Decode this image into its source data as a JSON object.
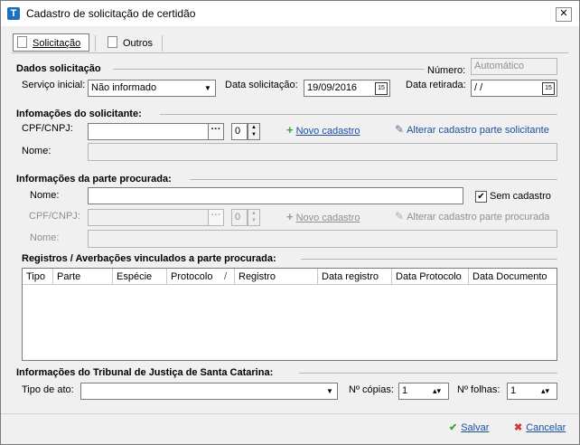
{
  "window": {
    "title": "Cadastro de solicitação de certidão",
    "close_glyph": "✕",
    "app_icon": "T"
  },
  "tabs": [
    {
      "label": "Solicitação"
    },
    {
      "label": "Outros"
    }
  ],
  "dados": {
    "heading": "Dados solicitação",
    "numero_label": "Número:",
    "numero_value": "Automático",
    "servico_label": "Serviço inicial:",
    "servico_value": "Não informado",
    "data_solic_label": "Data solicitação:",
    "data_solic_value": "19/09/2016",
    "data_ret_label": "Data retirada:",
    "data_ret_value": " /  /",
    "cal_glyph": "15"
  },
  "solicitante": {
    "heading": "Infomações do solicitante:",
    "cpf_label": "CPF/CNPJ:",
    "cpf_value": "",
    "dots": "···",
    "num_value": "0",
    "novo_label": "Novo cadastro",
    "alterar_label": "Alterar cadastro parte solicitante",
    "nome_label": "Nome:",
    "nome_value": ""
  },
  "parte": {
    "heading": "Informações da parte procurada:",
    "nome_label": "Nome:",
    "nome_value": "",
    "sem_cadastro_label": "Sem cadastro",
    "sem_cadastro_checked": true,
    "cpf_label": "CPF/CNPJ:",
    "num_value": "0",
    "dots": "···",
    "novo_label": "Novo cadastro",
    "alterar_label": "Alterar cadastro parte procurada",
    "nome2_label": "Nome:"
  },
  "registros": {
    "heading": "Registros / Averbações vinculados a parte procurada:",
    "columns": [
      "Tipo",
      "Parte",
      "Espécie",
      "Protocolo",
      "Registro",
      "Data registro",
      "Data Protocolo",
      "Data Documento"
    ],
    "sort_glyph": "/"
  },
  "tribunal": {
    "heading": "Informações do Tribunal de Justiça de Santa Catarina:",
    "tipo_label": "Tipo de ato:",
    "tipo_value": "",
    "copias_label": "Nº cópias:",
    "copias_value": "1",
    "folhas_label": "Nº folhas:",
    "folhas_value": "1"
  },
  "actions": {
    "salvar": "Salvar",
    "cancelar": "Cancelar"
  }
}
